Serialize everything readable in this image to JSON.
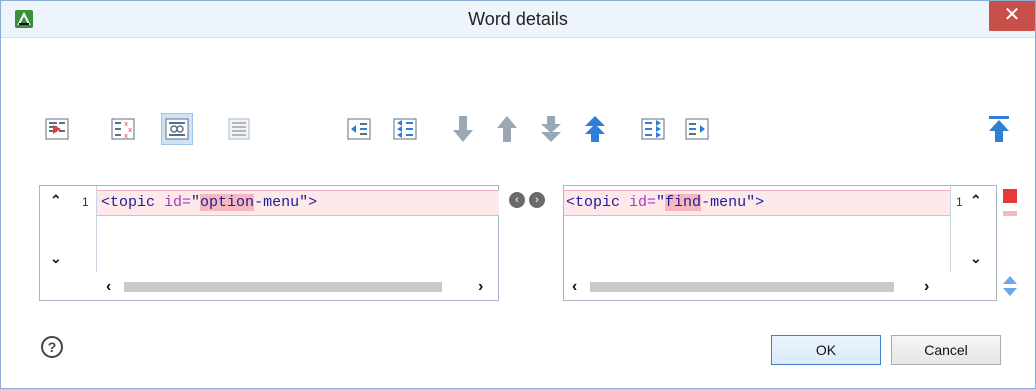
{
  "window": {
    "title": "Word details",
    "close_glyph": "✕"
  },
  "toolbar": {
    "buttons": [
      {
        "name": "show-modification-details-icon",
        "pressed": false
      },
      {
        "name": "ignore-whitespace-icon",
        "pressed": false
      },
      {
        "name": "synchronized-scrolling-icon",
        "pressed": true
      },
      {
        "name": "format-and-indent-icon",
        "pressed": false
      },
      {
        "name": "copy-change-left-icon",
        "pressed": false
      },
      {
        "name": "copy-all-changes-left-icon",
        "pressed": false
      },
      {
        "name": "next-change-icon",
        "pressed": false
      },
      {
        "name": "previous-change-icon",
        "pressed": false
      },
      {
        "name": "last-change-icon",
        "pressed": false
      },
      {
        "name": "first-change-icon",
        "pressed": false
      },
      {
        "name": "copy-all-changes-right-icon",
        "pressed": false
      },
      {
        "name": "copy-change-right-icon",
        "pressed": false
      },
      {
        "name": "go-to-first-icon",
        "pressed": false
      }
    ]
  },
  "left": {
    "line_number": "1",
    "code_prefix": "<topic ",
    "code_attr": "id=",
    "code_q1": "\"",
    "code_diff": "option",
    "code_rest": "-menu\">"
  },
  "right": {
    "line_number": "1",
    "code_prefix": "<topic ",
    "code_attr": "id=",
    "code_q1": "\"",
    "code_diff": "find",
    "code_rest": "-menu\">"
  },
  "buttons": {
    "ok": "OK",
    "cancel": "Cancel",
    "help": "?"
  },
  "colors": {
    "accent": "#2f7fd6",
    "diff_highlight": "#f7b7bd",
    "close": "#c7504b"
  }
}
